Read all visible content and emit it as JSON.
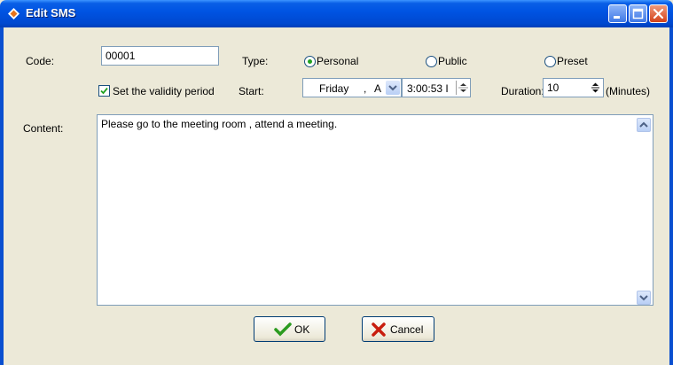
{
  "window": {
    "title": "Edit SMS"
  },
  "form": {
    "code_label": "Code:",
    "code_value": "00001",
    "type_label": "Type:",
    "type_options": [
      "Personal",
      "Public",
      "Preset"
    ],
    "type_selected": "Personal",
    "validity_label": "Set the validity period",
    "validity_checked": true,
    "start_label": "Start:",
    "start_day": "Friday",
    "start_sep": ",",
    "start_month_partial": "A",
    "start_time": "3:00:53 I",
    "duration_label": "Duration:",
    "duration_value": "10",
    "duration_unit": "(Minutes)",
    "content_label": "Content:",
    "content_text": "Please go to the meeting  room , attend a meeting."
  },
  "buttons": {
    "ok": "OK",
    "cancel": "Cancel"
  },
  "colors": {
    "titlebar": "#0054e3",
    "dialog_bg": "#ece9d8",
    "radio_selected": "#21a121",
    "ok_check": "#2b9b1f",
    "cancel_x": "#c81d0e"
  }
}
